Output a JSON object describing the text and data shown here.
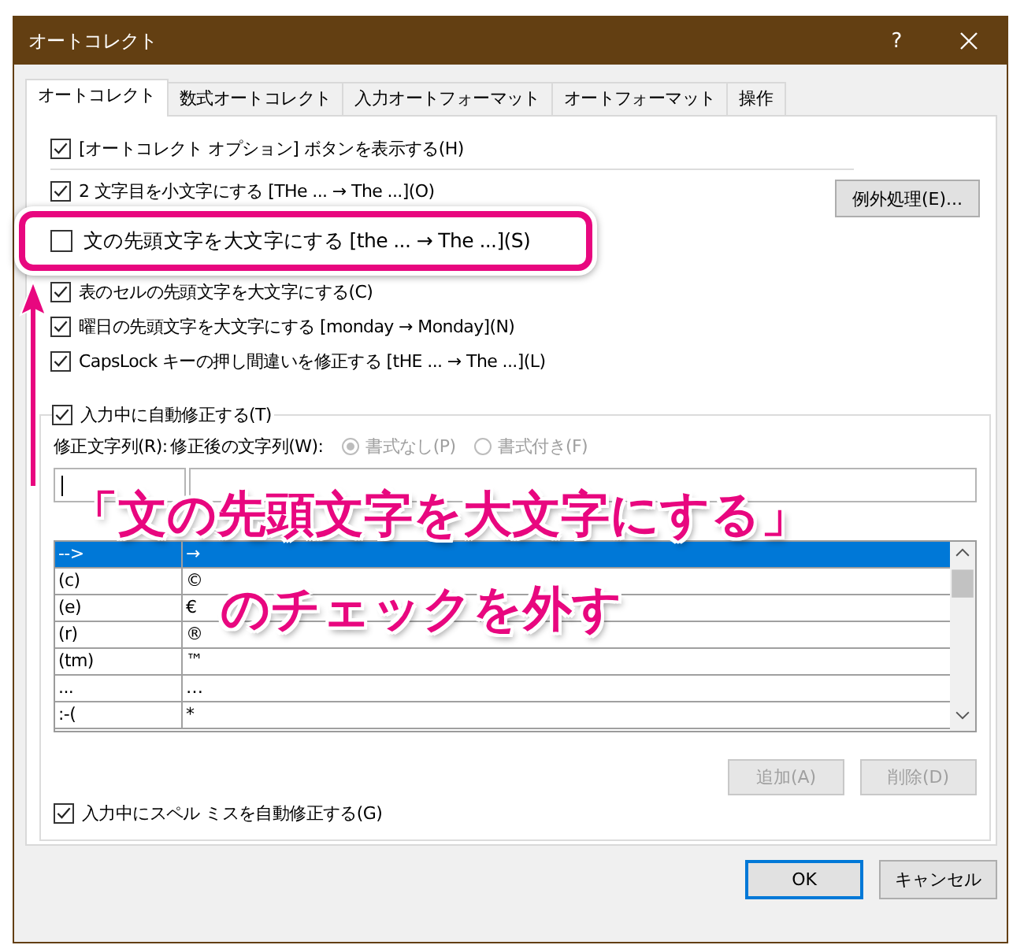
{
  "window": {
    "title": "オートコレクト",
    "help": "?"
  },
  "tabs": [
    {
      "label": "オートコレクト",
      "selected": true
    },
    {
      "label": "数式オートコレクト",
      "selected": false
    },
    {
      "label": "入力オートフォーマット",
      "selected": false
    },
    {
      "label": "オートフォーマット",
      "selected": false
    },
    {
      "label": "操作",
      "selected": false
    }
  ],
  "top_option": {
    "label": "[オートコレクト オプション] ボタンを表示する(H)",
    "checked": true
  },
  "options": [
    {
      "label": "2 文字目を小文字にする [THe ... → The ...](O)",
      "checked": true,
      "highlighted": false
    },
    {
      "label": "文の先頭文字を大文字にする [the ... → The ...](S)",
      "checked": false,
      "highlighted": true
    },
    {
      "label": "表のセルの先頭文字を大文字にする(C)",
      "checked": true,
      "highlighted": false
    },
    {
      "label": "曜日の先頭文字を大文字にする [monday →  Monday](N)",
      "checked": true,
      "highlighted": false
    },
    {
      "label": "CapsLock キーの押し間違いを修正する [tHE ... → The ...](L)",
      "checked": true,
      "highlighted": false
    }
  ],
  "exceptions_button": "例外処理(E)...",
  "replace_group": {
    "label": "入力中に自動修正する(T)",
    "checked": true,
    "replace_label": "修正文字列(R):",
    "with_label": "修正後の文字列(W):",
    "radios": [
      {
        "label": "書式なし(P)",
        "selected": true,
        "disabled": true
      },
      {
        "label": "書式付き(F)",
        "selected": false,
        "disabled": true
      }
    ],
    "rows": [
      {
        "replace": "-->",
        "with": "→",
        "selected": true
      },
      {
        "replace": "(c)",
        "with": "©",
        "selected": false
      },
      {
        "replace": "(e)",
        "with": "€",
        "selected": false
      },
      {
        "replace": "(r)",
        "with": "®",
        "selected": false
      },
      {
        "replace": "(tm)",
        "with": "™",
        "selected": false
      },
      {
        "replace": "...",
        "with": "…",
        "selected": false
      },
      {
        "replace": ":-(",
        "with": "*",
        "selected": false
      }
    ],
    "buttons": [
      {
        "label": "追加(A)",
        "disabled": true
      },
      {
        "label": "削除(D)",
        "disabled": true
      }
    ]
  },
  "spell_option": {
    "label": "入力中にスペル ミスを自動修正する(G)",
    "checked": true
  },
  "dialog_buttons": [
    {
      "label": "OK",
      "default": true
    },
    {
      "label": "キャンセル",
      "default": false
    }
  ],
  "annotation": {
    "caption": [
      "「文の先頭文字を大文字にする」",
      "のチェックを外す"
    ]
  }
}
